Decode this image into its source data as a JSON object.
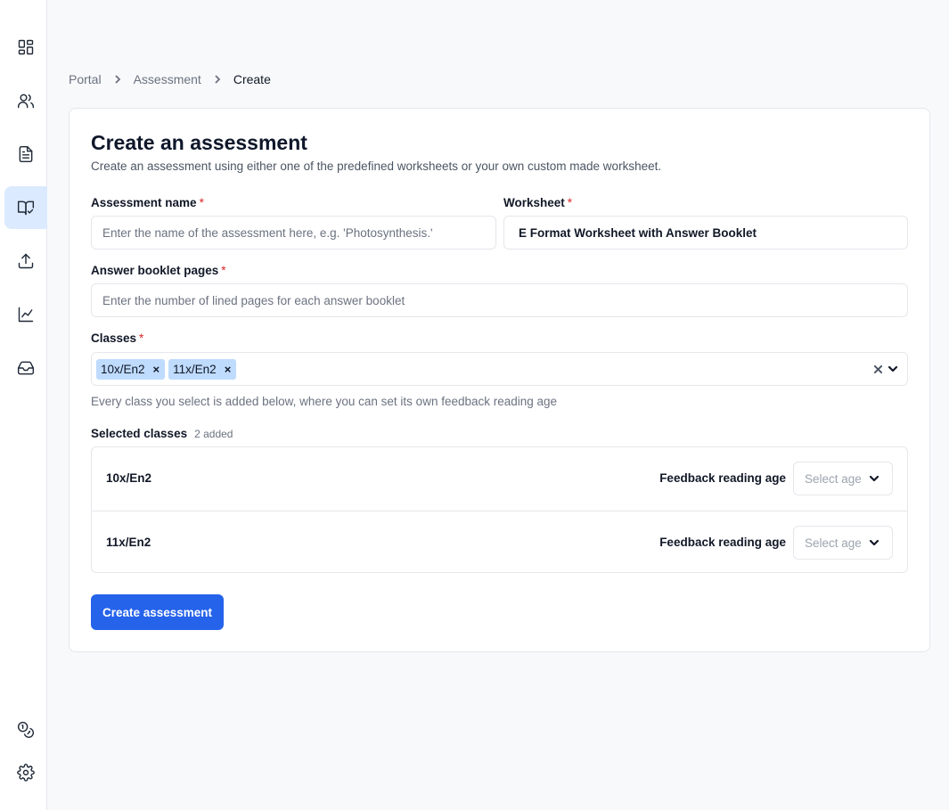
{
  "sidebar": {
    "items": [
      {
        "icon": "dashboard-icon"
      },
      {
        "icon": "users-icon"
      },
      {
        "icon": "document-icon"
      },
      {
        "icon": "book-check-icon",
        "active": true
      },
      {
        "icon": "upload-icon"
      },
      {
        "icon": "chart-icon"
      },
      {
        "icon": "inbox-icon"
      }
    ],
    "bottom_items": [
      {
        "icon": "coins-icon"
      },
      {
        "icon": "gear-icon"
      }
    ]
  },
  "breadcrumb": {
    "items": [
      "Portal",
      "Assessment",
      "Create"
    ]
  },
  "form": {
    "title": "Create an assessment",
    "subtitle": "Create an assessment using either one of the predefined worksheets or your own custom made worksheet.",
    "assessment_name": {
      "label": "Assessment name",
      "required_mark": "*",
      "placeholder": "Enter the name of the assessment here, e.g. 'Photosynthesis.'",
      "value": ""
    },
    "worksheet": {
      "label": "Worksheet",
      "required_mark": "*",
      "value": "E Format Worksheet with Answer Booklet"
    },
    "answer_booklet_pages": {
      "label": "Answer booklet pages",
      "required_mark": "*",
      "placeholder": "Enter the number of lined pages for each answer booklet",
      "value": ""
    },
    "classes": {
      "label": "Classes",
      "required_mark": "*",
      "chips": [
        "10x/En2",
        "11x/En2"
      ],
      "chip_remove": "×",
      "help": "Every class you select is added below, where you can set its own feedback reading age"
    },
    "selected_classes": {
      "title": "Selected classes",
      "count": "2 added",
      "rows": [
        {
          "name": "10x/En2",
          "field_label": "Feedback reading age",
          "placeholder": "Select age"
        },
        {
          "name": "11x/En2",
          "field_label": "Feedback reading age",
          "placeholder": "Select age"
        }
      ]
    },
    "submit_label": "Create assessment"
  },
  "colors": {
    "accent": "#2563eb",
    "chip": "#bfdbfe",
    "active_nav": "#dbeafe",
    "required": "#dc2626"
  }
}
